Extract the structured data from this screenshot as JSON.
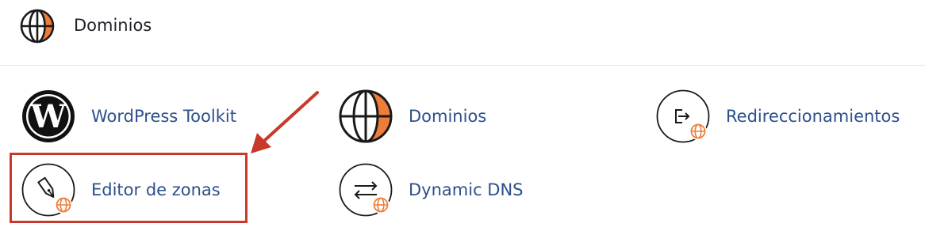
{
  "section": {
    "title": "Dominios",
    "icon": "globe-icon"
  },
  "tools": [
    {
      "label": "WordPress Toolkit",
      "icon": "wordpress-icon"
    },
    {
      "label": "Dominios",
      "icon": "globe-icon"
    },
    {
      "label": "Redireccionamientos",
      "icon": "redirect-globe-icon"
    },
    {
      "label": "Editor de zonas",
      "icon": "pen-globe-icon"
    },
    {
      "label": "Dynamic DNS",
      "icon": "swap-arrows-globe-icon"
    }
  ],
  "colors": {
    "accent_orange": "#ee7d3a",
    "link_blue": "#2d4f8c",
    "annotation_red": "#c8392b",
    "text_dark": "#1f2228"
  }
}
